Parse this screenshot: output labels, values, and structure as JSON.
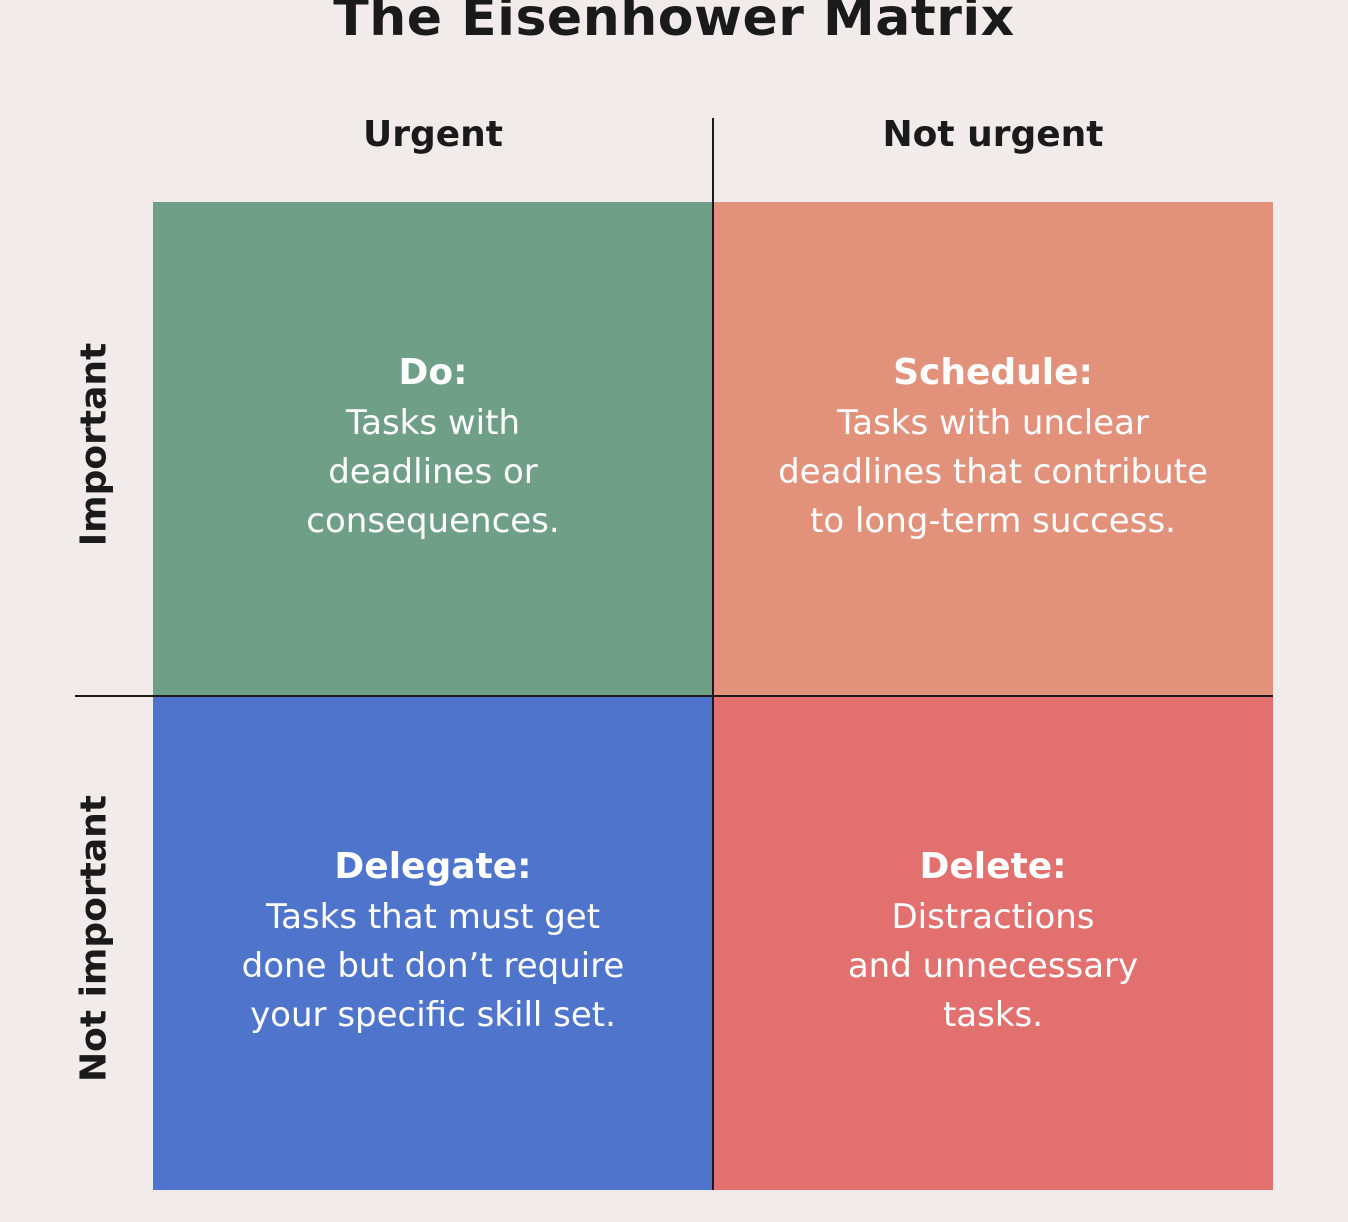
{
  "title": "The Eisenhower Matrix",
  "columns": [
    "Urgent",
    "Not urgent"
  ],
  "rows": [
    "Important",
    "Not important"
  ],
  "quadrants": [
    {
      "heading": "Do:",
      "lines": [
        "Tasks with",
        "deadlines or",
        "consequences."
      ],
      "color": "#6f9f87"
    },
    {
      "heading": "Schedule:",
      "lines": [
        "Tasks with unclear",
        "deadlines that contribute",
        "to long-term success."
      ],
      "color": "#e2917a"
    },
    {
      "heading": "Delegate:",
      "lines": [
        "Tasks that must get",
        "done but don’t require",
        "your specific skill set."
      ],
      "color": "#4e74cc"
    },
    {
      "heading": "Delete:",
      "lines": [
        "Distractions",
        "and unnecessary",
        "tasks."
      ],
      "color": "#e2706e"
    }
  ]
}
